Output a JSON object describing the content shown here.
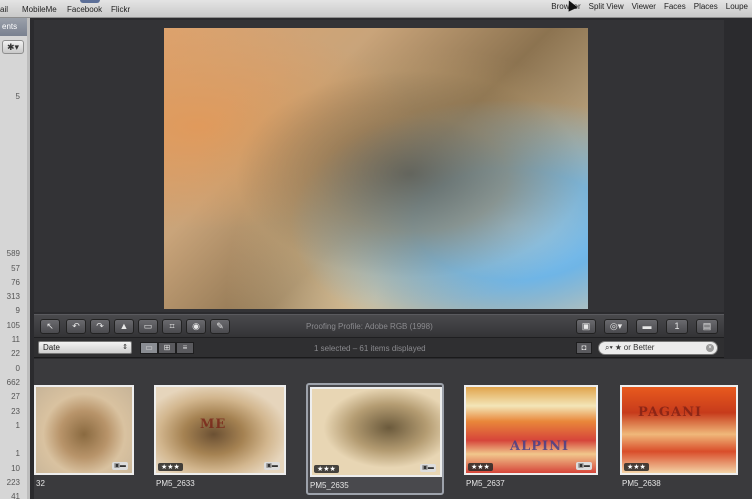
{
  "top_toolbar": {
    "share_items": [
      "ail",
      "MobileMe",
      "Facebook",
      "Flickr"
    ],
    "view_items": [
      "Browser",
      "Split View",
      "Viewer",
      "Faces",
      "Places",
      "Loupe"
    ]
  },
  "inspector": {
    "header": "ents",
    "gear_label": "✱▾",
    "counts": [
      "5",
      "",
      "",
      "",
      "",
      "",
      "",
      "",
      "",
      "",
      "",
      "589",
      "57",
      "76",
      "313",
      "9",
      "105",
      "11",
      "22",
      "0",
      "662",
      "27",
      "23",
      "1",
      "",
      "1",
      "10",
      "223",
      "41"
    ]
  },
  "viewer_toolbar": {
    "proofing_profile": "Proofing Profile: Adobe RGB (1998)"
  },
  "browser": {
    "sort_by": "Date",
    "count_text": "1 selected – 61 items displayed",
    "filter_text": "★ or Better"
  },
  "filmstrip": [
    {
      "name": "32",
      "stars": "",
      "label": ""
    },
    {
      "name": "PM5_2633",
      "stars": "★★★",
      "label": "ME"
    },
    {
      "name": "PM5_2635",
      "stars": "★★★",
      "label": ""
    },
    {
      "name": "PM5_2637",
      "stars": "★★★",
      "label": "ALPINI"
    },
    {
      "name": "PM5_2638",
      "stars": "★★★",
      "label": "PAGANI"
    }
  ],
  "colors": {
    "viewer_bg": "#333336",
    "strip_bg": "#3a3a3d",
    "selection": "#9da2ab"
  }
}
